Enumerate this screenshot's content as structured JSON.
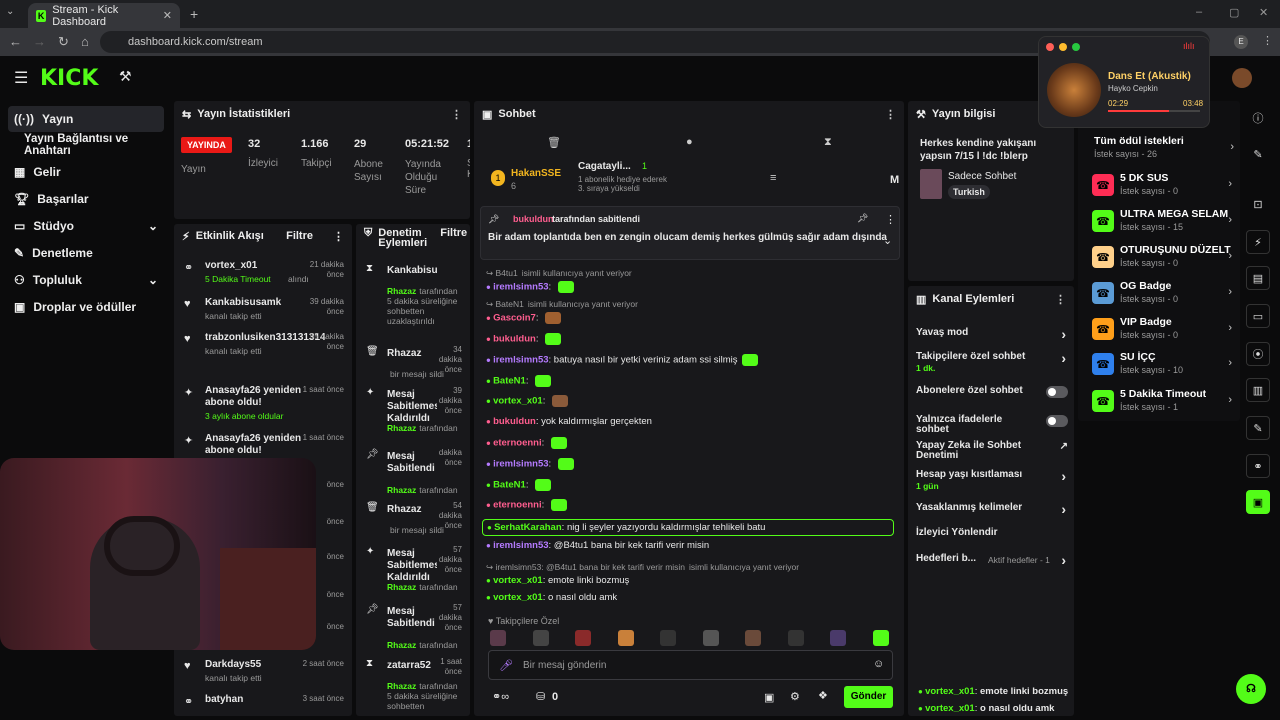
{
  "browser": {
    "tab_title": "Stream - Kick Dashboard",
    "url": "dashboard.kick.com/stream",
    "profile_initial": "E"
  },
  "sidebar": {
    "items": [
      {
        "label": "Yayın"
      },
      {
        "label": "Yayın Bağlantısı ve Anahtarı"
      },
      {
        "label": "Gelir"
      },
      {
        "label": "Başarılar"
      },
      {
        "label": "Stüdyo"
      },
      {
        "label": "Denetleme"
      },
      {
        "label": "Topluluk"
      },
      {
        "label": "Droplar ve ödüller"
      }
    ]
  },
  "stats": {
    "title": "Yayın İstatistikleri",
    "live_badge": "YAYINDA",
    "live_label": "Yayın",
    "items": [
      {
        "value": "32",
        "label": "İzleyici"
      },
      {
        "value": "1.166",
        "label": "Takipçi"
      },
      {
        "value": "29",
        "label": "Abone Sayısı"
      },
      {
        "value": "05:21:52",
        "label": "Yayında Olduğu Süre"
      },
      {
        "value": "1",
        "label": "S K"
      }
    ]
  },
  "activity": {
    "title": "Etkinlik Akışı",
    "filter": "Filtre",
    "events": [
      {
        "user": "vortex_x01",
        "detail": "5 Dakika Timeout",
        "detail2": "alındı",
        "time": "21 dakika önce"
      },
      {
        "user": "Kankabisusamk",
        "detail": "kanalı takip etti",
        "time": "39 dakika önce"
      },
      {
        "user": "trabzonlusiken313131314",
        "detail": "kanalı takip etti",
        "time": "55 dakika önce"
      },
      {
        "user": "Anasayfa26 yeniden abone oldu!",
        "detail": "3 aylık abone oldular",
        "time": "1 saat önce"
      },
      {
        "user": "Anasayfa26 yeniden abone oldu!",
        "detail": "",
        "time": "1 saat önce"
      },
      {
        "user": "",
        "detail": "",
        "time": "önce"
      },
      {
        "user": "",
        "detail": "",
        "time": "önce"
      },
      {
        "user": "",
        "detail": "",
        "time": "önce"
      },
      {
        "user": "",
        "detail": "",
        "time": "önce"
      },
      {
        "user": "",
        "detail": "",
        "time": "önce"
      },
      {
        "user": "Darkdays55",
        "detail": "kanalı takip etti",
        "time": "2 saat önce"
      },
      {
        "user": "batyhan",
        "detail": "",
        "time": "3 saat önce"
      }
    ]
  },
  "moderation": {
    "title": "Denetim Eylemleri",
    "filter": "Filtre",
    "items": [
      {
        "action": "Kankabisusamk",
        "who": "Rhazaz",
        "rest": "tarafından 5 dakika süreliğine sohbetten uzaklaştırıldı",
        "time": ""
      },
      {
        "action": "Rhazaz",
        "who": "",
        "rest": "bir mesajı sildi",
        "time": "34 dakika önce"
      },
      {
        "action": "Mesaj Sabitlemesi Kaldırıldı",
        "who": "Rhazaz",
        "rest": "tarafından",
        "time": "39 dakika önce"
      },
      {
        "action": "Mesaj Sabitlendi",
        "who": "Rhazaz",
        "rest": "tarafından",
        "time": "dakika önce"
      },
      {
        "action": "Rhazaz",
        "who": "",
        "rest": "bir mesajı sildi",
        "time": "54 dakika önce"
      },
      {
        "action": "Mesaj Sabitlemesi Kaldırıldı",
        "who": "Rhazaz",
        "rest": "tarafından",
        "time": "57 dakika önce"
      },
      {
        "action": "Mesaj Sabitlendi",
        "who": "Rhazaz",
        "rest": "tarafından",
        "time": "57 dakika önce"
      },
      {
        "action": "zatarra52",
        "who": "Rhazaz",
        "rest": "tarafından 5 dakika süreliğine sohbetten",
        "time": "1 saat önce"
      }
    ]
  },
  "chat": {
    "title": "Sohbet",
    "top_gifter": "HakanSSE",
    "top_gifter_count": "6",
    "gift_user": "Cagatayli...",
    "gift_count": "1",
    "gift_text": "1 abonelik hediye ederek 3. sıraya yükseldi",
    "gift_extra": "M",
    "pinned_by": "bukuldun",
    "pinned_suffix": "tarafından sabitlendi",
    "pinned_text": "Bir adam toplantıda ben en zengin olucam demiş herkes gülmüş sağır adam dışında",
    "lines": [
      {
        "reply": "B4tu1",
        "reply_text": "isimli kullanıcıya yanıt veriyor",
        "user": "iremlsimn53",
        "text": "",
        "color": "#b57bff"
      },
      {
        "reply": "BateN1",
        "reply_text": "isimli kullanıcıya yanıt veriyor",
        "user": "Gascoin7",
        "text": "",
        "color": "#ff5e8f"
      },
      {
        "user": "bukuldun",
        "text": "",
        "color": "#ff5e8f"
      },
      {
        "user": "iremlsimn53",
        "text": "batuya nasıl bir yetki veriniz adam ssi silmiş",
        "color": "#b57bff"
      },
      {
        "user": "BateN1",
        "text": "",
        "color": "#53fc18"
      },
      {
        "user": "vortex_x01",
        "text": "",
        "color": "#53fc18"
      },
      {
        "user": "bukuldun",
        "text": "yok kaldırmışlar gerçekten",
        "color": "#ff5e8f"
      },
      {
        "user": "eternoenni",
        "text": "",
        "color": "#ff5e8f"
      },
      {
        "user": "iremlsimn53",
        "text": "",
        "color": "#b57bff"
      },
      {
        "user": "BateN1",
        "text": "",
        "color": "#53fc18"
      },
      {
        "user": "eternoenni",
        "text": "",
        "color": "#ff5e8f"
      },
      {
        "user": "SerhatKarahan",
        "text": "nig li şeyler yazıyordu kaldırmışlar tehlikeli batu",
        "color": "#53fc18"
      },
      {
        "user": "iremlsimn53",
        "text": "@B4tu1 bana bir kek tarifi verir misin",
        "color": "#b57bff"
      },
      {
        "reply": "iremlsimn53: @B4tu1 bana bir kek tarifi verir misin",
        "reply_text": "isimli kullanıcıya yanıt veriyor",
        "user": "vortex_x01",
        "text": "emote linki bozmuş",
        "color": "#53fc18"
      },
      {
        "user": "vortex_x01",
        "text": "o nasıl oldu amk",
        "color": "#53fc18"
      }
    ],
    "followers_label": "Takipçilere Özel",
    "input_placeholder": "Bir mesaj gönderin",
    "points": "0",
    "send": "Gönder"
  },
  "stream_info": {
    "title": "Yayın bilgisi",
    "stream_title": "Herkes kendine yakışanı yapsın 7/15 l !dc !blerp",
    "category": "Sadece Sohbet",
    "tag": "Turkish"
  },
  "channel_actions": {
    "title": "Kanal Eylemleri",
    "items": [
      {
        "label": "Yavaş mod",
        "sub": ""
      },
      {
        "label": "Takipçilere özel sohbet",
        "sub": "1 dk."
      },
      {
        "label": "Abonelere özel sohbet",
        "sub": ""
      },
      {
        "label": "Yalnızca ifadelerle sohbet",
        "sub": ""
      },
      {
        "label": "Yapay Zeka ile Sohbet Denetimi",
        "sub": ""
      },
      {
        "label": "Hesap yaşı kısıtlaması",
        "sub": "1 gün"
      },
      {
        "label": "Yasaklanmış kelimeler",
        "sub": ""
      },
      {
        "label": "İzleyici Yönlendir",
        "sub": ""
      },
      {
        "label": "Hedefleri b...",
        "sub": "Aktif hedefler - 1"
      }
    ]
  },
  "rewards": {
    "all_label": "Tüm ödül istekleri",
    "all_sub": "İstek sayısı - 26",
    "items": [
      {
        "title": "5 DK SUS",
        "sub": "İstek sayısı - 0",
        "color": "#ff2d55"
      },
      {
        "title": "ULTRA MEGA SELAM",
        "sub": "İstek sayısı - 15",
        "color": "#53fc18"
      },
      {
        "title": "OTURUŞUNU DÜZELT",
        "sub": "İstek sayısı - 0",
        "color": "#ffd08a"
      },
      {
        "title": "OG Badge",
        "sub": "İstek sayısı - 0",
        "color": "#5b9bd5"
      },
      {
        "title": "VIP Badge",
        "sub": "İstek sayısı - 0",
        "color": "#ff9f1a"
      },
      {
        "title": "SU İÇÇ",
        "sub": "İstek sayısı - 10",
        "color": "#2f80ed"
      },
      {
        "title": "5 Dakika Timeout",
        "sub": "İstek sayısı - 1",
        "color": "#53fc18"
      }
    ]
  },
  "bottom_chat": [
    {
      "user": "vortex_x01",
      "text": "emote linki bozmuş"
    },
    {
      "user": "vortex_x01",
      "text": "o nasıl oldu amk"
    }
  ],
  "music": {
    "title": "Dans Et (Akustik)",
    "artist": "Hayko Cepkin",
    "elapsed": "02:29",
    "total": "03:48",
    "progress": 0.66
  }
}
